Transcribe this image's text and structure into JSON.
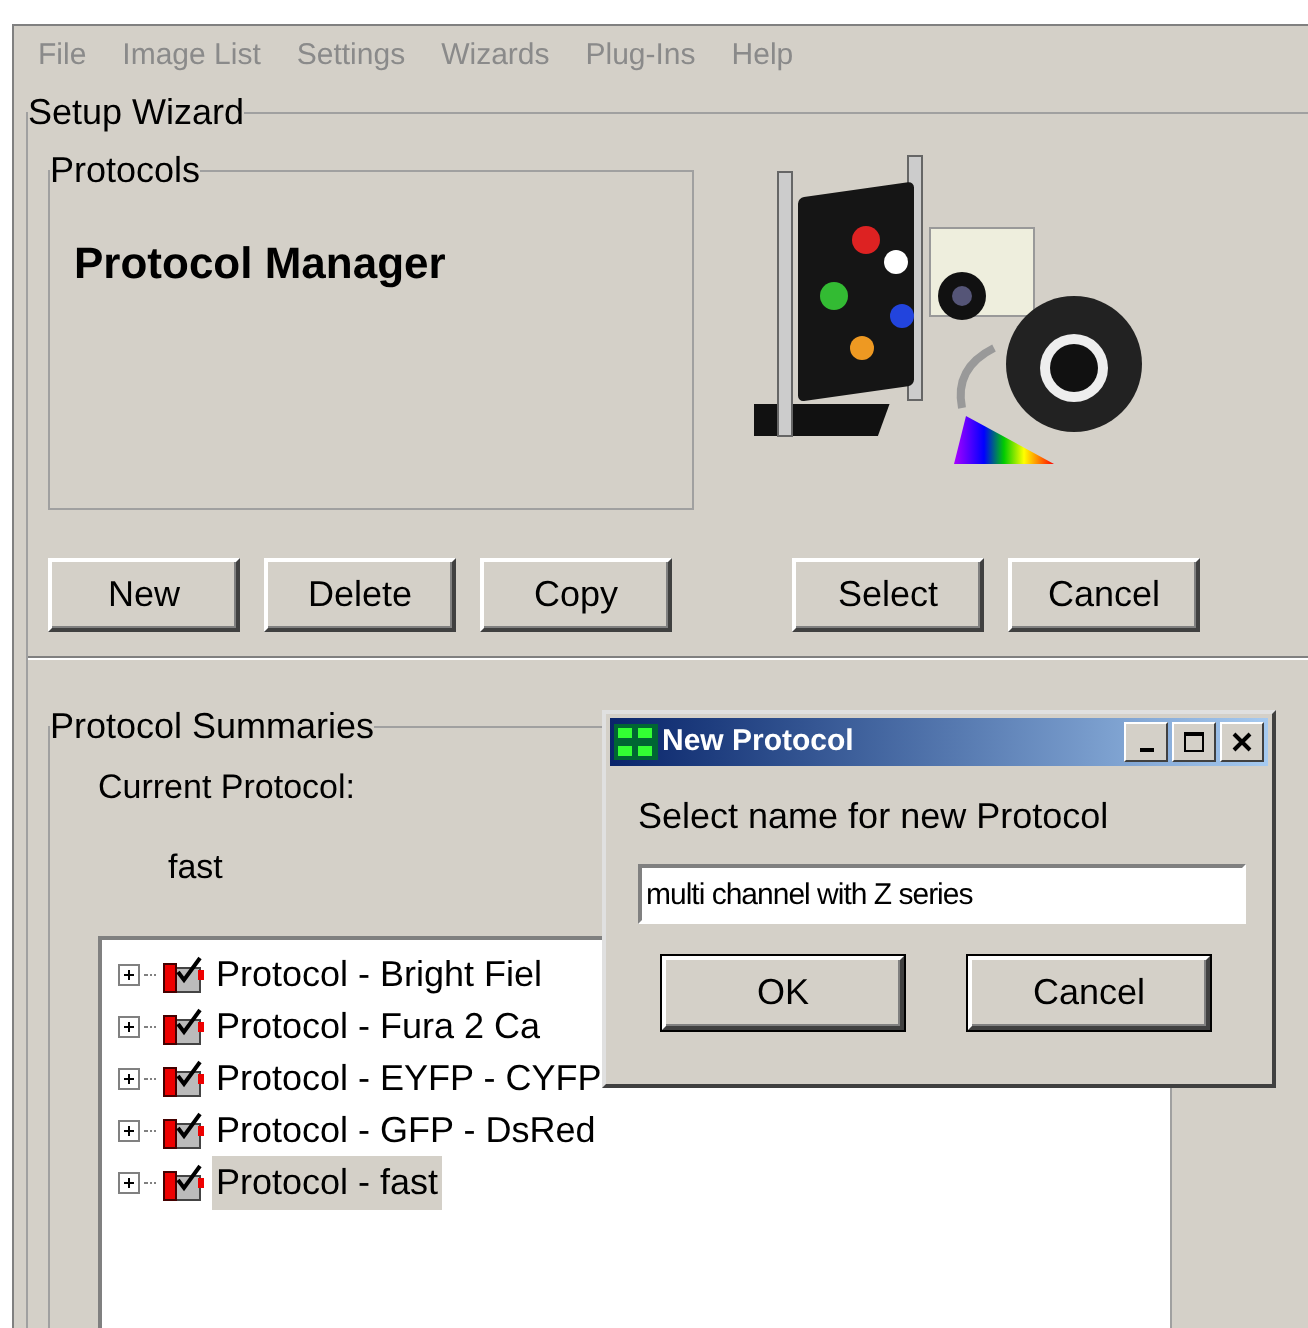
{
  "menu": [
    {
      "label": "File",
      "disabled": true
    },
    {
      "label": "Image List",
      "disabled": true
    },
    {
      "label": "Settings",
      "disabled": true
    },
    {
      "label": "Wizards",
      "disabled": true
    },
    {
      "label": "Plug-Ins",
      "disabled": true
    },
    {
      "label": "Help",
      "disabled": true
    }
  ],
  "wizard": {
    "title": "Setup Wizard",
    "protocols": {
      "title": "Protocols",
      "heading": "Protocol Manager"
    },
    "buttons": [
      {
        "label": "New"
      },
      {
        "label": "Delete"
      },
      {
        "label": "Copy"
      },
      {
        "label": "Select"
      },
      {
        "label": "Cancel"
      }
    ],
    "summaries": {
      "title": "Protocol Summaries",
      "current_label": "Current Protocol:",
      "current_value": "fast",
      "tree": [
        {
          "label": "Protocol - Bright Fiel",
          "expanded": false,
          "selected": false
        },
        {
          "label": "Protocol - Fura 2 Ca",
          "expanded": false,
          "selected": false
        },
        {
          "label": "Protocol - EYFP - CYFP",
          "expanded": false,
          "selected": false
        },
        {
          "label": "Protocol - GFP - DsRed",
          "expanded": false,
          "selected": false
        },
        {
          "label": "Protocol - fast",
          "expanded": false,
          "selected": true
        }
      ]
    }
  },
  "dialog": {
    "title": "New Protocol",
    "prompt": "Select name for new Protocol",
    "value": "multi channel with Z series",
    "buttons": [
      {
        "label": "OK"
      },
      {
        "label": "Cancel"
      }
    ]
  }
}
